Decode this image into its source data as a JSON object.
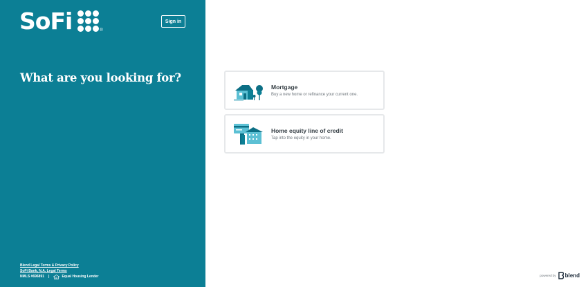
{
  "brand": {
    "name": "SoFi",
    "registered_mark": "®",
    "accent_color": "#0c7f95"
  },
  "header": {
    "signin_label": "Sign in"
  },
  "main": {
    "headline": "What are you looking for?",
    "options": [
      {
        "title": "Mortgage",
        "description": "Buy a new home or refinance your current one.",
        "icon": "house-with-tree-icon"
      },
      {
        "title": "Home equity line of credit",
        "description": "Tap into the equity in your home.",
        "icon": "house-with-card-icon"
      }
    ]
  },
  "footer": {
    "links": [
      "Blend Legal Terms & Privacy Policy",
      "SoFi Bank, N.A. Legal Terms"
    ],
    "nmls": "NMLS #696891",
    "separator": "|",
    "equal_housing": "Equal Housing Lender"
  },
  "powered_by": {
    "label": "powered by",
    "brand": "blend"
  }
}
